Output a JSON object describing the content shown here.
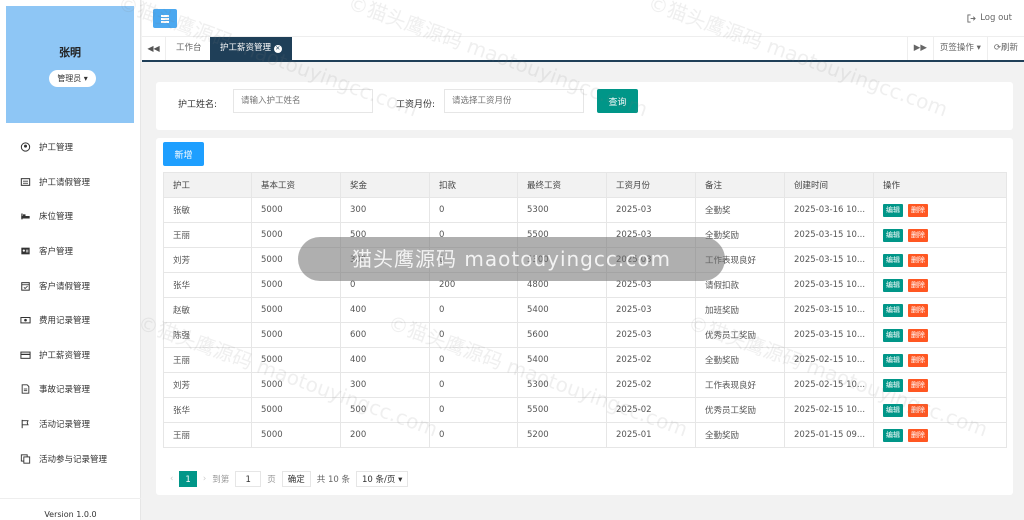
{
  "user": {
    "name": "张明",
    "role": "管理员"
  },
  "sidebar": {
    "items": [
      {
        "label": "护工管理",
        "icon": "user-circle-icon"
      },
      {
        "label": "护工请假管理",
        "icon": "list-icon"
      },
      {
        "label": "床位管理",
        "icon": "bed-icon"
      },
      {
        "label": "客户管理",
        "icon": "contact-card-icon"
      },
      {
        "label": "客户请假管理",
        "icon": "calendar-check-icon"
      },
      {
        "label": "费用记录管理",
        "icon": "money-icon"
      },
      {
        "label": "护工薪资管理",
        "icon": "credit-card-icon"
      },
      {
        "label": "事故记录管理",
        "icon": "file-text-icon"
      },
      {
        "label": "活动记录管理",
        "icon": "flag-icon"
      },
      {
        "label": "活动参与记录管理",
        "icon": "copy-icon"
      }
    ],
    "version": "Version 1.0.0"
  },
  "header": {
    "logout": "Log out"
  },
  "tabs": {
    "items": [
      {
        "label": "工作台"
      },
      {
        "label": "护工薪资管理"
      }
    ],
    "page_ops": "页签操作",
    "refresh": "刷新"
  },
  "search": {
    "name_label": "护工姓名:",
    "name_placeholder": "请输入护工姓名",
    "month_label": "工资月份:",
    "month_placeholder": "请选择工资月份",
    "query_button": "查询"
  },
  "table": {
    "add_button": "新增",
    "columns": [
      "护工",
      "基本工资",
      "奖金",
      "扣款",
      "最终工资",
      "工资月份",
      "备注",
      "创建时间",
      "操作"
    ],
    "edit_label": "编辑",
    "delete_label": "删除",
    "rows": [
      [
        "张敏",
        "5000",
        "300",
        "0",
        "5300",
        "2025-03",
        "全勤奖",
        "2025-03-16 10..."
      ],
      [
        "王丽",
        "5000",
        "500",
        "0",
        "5500",
        "2025-03",
        "全勤奖励",
        "2025-03-15 10..."
      ],
      [
        "刘芳",
        "5000",
        "300",
        "0",
        "5300",
        "2025-03",
        "工作表现良好",
        "2025-03-15 10..."
      ],
      [
        "张华",
        "5000",
        "0",
        "200",
        "4800",
        "2025-03",
        "请假扣款",
        "2025-03-15 10..."
      ],
      [
        "赵敏",
        "5000",
        "400",
        "0",
        "5400",
        "2025-03",
        "加班奖励",
        "2025-03-15 10..."
      ],
      [
        "陈强",
        "5000",
        "600",
        "0",
        "5600",
        "2025-03",
        "优秀员工奖励",
        "2025-03-15 10..."
      ],
      [
        "王丽",
        "5000",
        "400",
        "0",
        "5400",
        "2025-02",
        "全勤奖励",
        "2025-02-15 10..."
      ],
      [
        "刘芳",
        "5000",
        "300",
        "0",
        "5300",
        "2025-02",
        "工作表现良好",
        "2025-02-15 10..."
      ],
      [
        "张华",
        "5000",
        "500",
        "0",
        "5500",
        "2025-02",
        "优秀员工奖励",
        "2025-02-15 10..."
      ],
      [
        "王丽",
        "5000",
        "200",
        "0",
        "5200",
        "2025-01",
        "全勤奖励",
        "2025-01-15 09..."
      ]
    ]
  },
  "pager": {
    "current": "1",
    "goto_label": "到第",
    "page_value": "1",
    "page_unit": "页",
    "confirm": "确定",
    "total": "共 10 条",
    "page_size": "10 条/页"
  },
  "watermark": {
    "center": "猫头鹰源码 maotouyingcc.com",
    "tiles": [
      "©猫头鹰源码 maotouyingcc.com"
    ]
  }
}
